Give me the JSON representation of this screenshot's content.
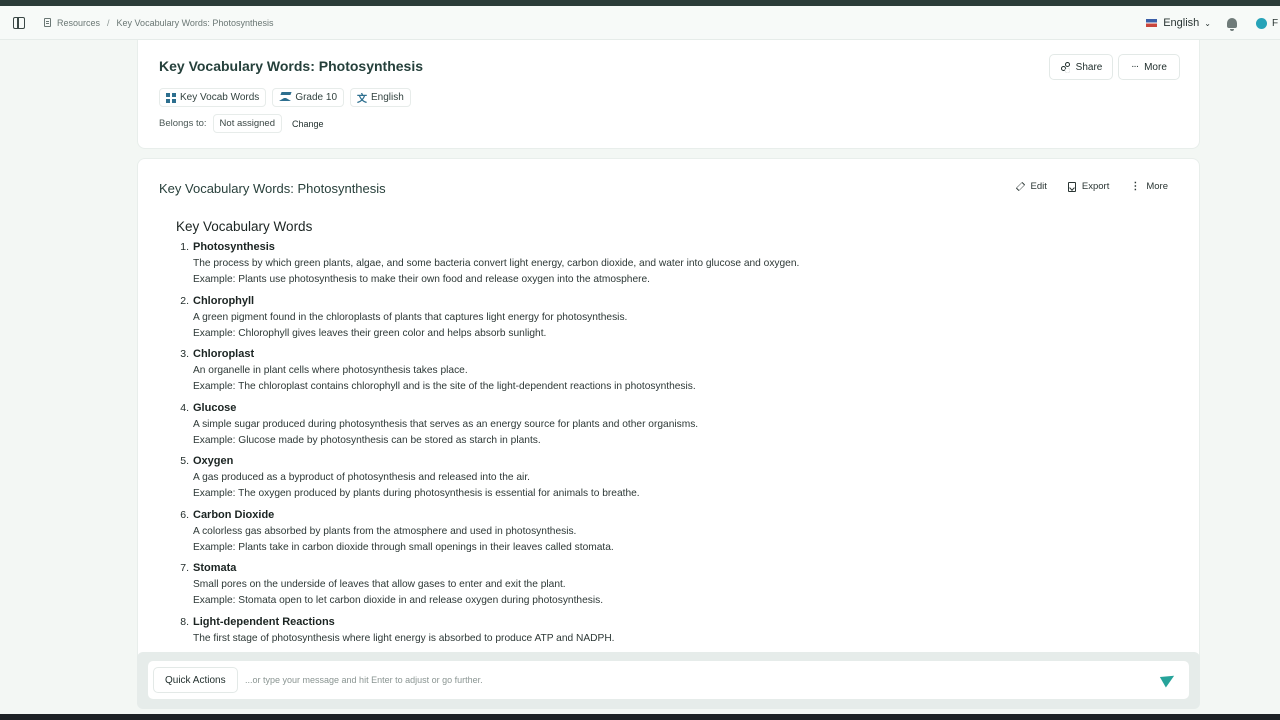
{
  "topbar": {
    "breadcrumb": [
      "Resources",
      "Key Vocabulary Words: Photosynthesis"
    ],
    "breadcrumb_separator": "/",
    "language": "English",
    "user_initial": "F"
  },
  "header_card": {
    "title": "Key Vocabulary Words: Photosynthesis",
    "share_label": "Share",
    "more_label": "More",
    "tags": [
      {
        "label": "Key Vocab Words",
        "icon": "grid-icon"
      },
      {
        "label": "Grade 10",
        "icon": "graduation-cap-icon"
      },
      {
        "label": "English",
        "icon": "translate-icon"
      }
    ],
    "belongs_to_label": "Belongs to:",
    "belongs_to_value": "Not assigned",
    "change_label": "Change"
  },
  "document": {
    "title": "Key Vocabulary Words: Photosynthesis",
    "actions": {
      "edit": "Edit",
      "export": "Export",
      "more": "More"
    },
    "heading": "Key Vocabulary Words",
    "items": [
      {
        "num": "1.",
        "term": "Photosynthesis",
        "definition": "The process by which green plants, algae, and some bacteria convert light energy, carbon dioxide, and water into glucose and oxygen.",
        "example": "Example: Plants use photosynthesis to make their own food and release oxygen into the atmosphere."
      },
      {
        "num": "2.",
        "term": "Chlorophyll",
        "definition": "A green pigment found in the chloroplasts of plants that captures light energy for photosynthesis.",
        "example": "Example: Chlorophyll gives leaves their green color and helps absorb sunlight."
      },
      {
        "num": "3.",
        "term": "Chloroplast",
        "definition": "An organelle in plant cells where photosynthesis takes place.",
        "example": "Example: The chloroplast contains chlorophyll and is the site of the light-dependent reactions in photosynthesis."
      },
      {
        "num": "4.",
        "term": "Glucose",
        "definition": "A simple sugar produced during photosynthesis that serves as an energy source for plants and other organisms.",
        "example": "Example: Glucose made by photosynthesis can be stored as starch in plants."
      },
      {
        "num": "5.",
        "term": "Oxygen",
        "definition": "A gas produced as a byproduct of photosynthesis and released into the air.",
        "example": "Example: The oxygen produced by plants during photosynthesis is essential for animals to breathe."
      },
      {
        "num": "6.",
        "term": "Carbon Dioxide",
        "definition": "A colorless gas absorbed by plants from the atmosphere and used in photosynthesis.",
        "example": "Example: Plants take in carbon dioxide through small openings in their leaves called stomata."
      },
      {
        "num": "7.",
        "term": "Stomata",
        "definition": "Small pores on the underside of leaves that allow gases to enter and exit the plant.",
        "example": "Example: Stomata open to let carbon dioxide in and release oxygen during photosynthesis."
      },
      {
        "num": "8.",
        "term": "Light-dependent Reactions",
        "definition": "The first stage of photosynthesis where light energy is absorbed to produce ATP and NADPH.",
        "example": ""
      }
    ]
  },
  "chat": {
    "quick_actions_label": "Quick Actions",
    "input_placeholder": "...or type your message and hit Enter to adjust or go further.",
    "input_value": ""
  },
  "colors": {
    "accent": "#26a39a",
    "background": "#f3f7f4",
    "title_text": "#25403b"
  }
}
